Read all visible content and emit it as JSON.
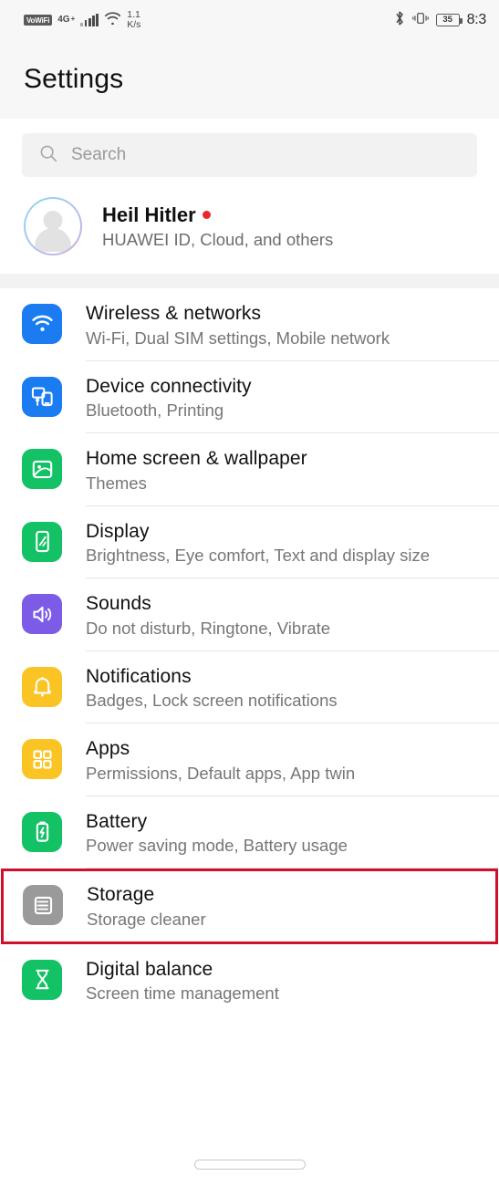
{
  "status_bar": {
    "vowifi_label": "VoWiFi",
    "network_type": "4G",
    "network_type_plus": "+",
    "speed_value": "1.1",
    "speed_unit": "K/s",
    "bluetooth_icon": "bluetooth-icon",
    "vibrate_icon": "vibrate-icon",
    "battery_percent": "35",
    "time": "8:3"
  },
  "header": {
    "title": "Settings"
  },
  "search": {
    "placeholder": "Search",
    "icon": "search-icon"
  },
  "account": {
    "name": "Heil Hitler",
    "subtitle": "HUAWEI ID, Cloud, and others",
    "has_notification_dot": true,
    "avatar_icon": "person-avatar-icon"
  },
  "settings_items": [
    {
      "title": "Wireless & networks",
      "subtitle": "Wi-Fi, Dual SIM settings, Mobile network",
      "icon": "wifi-icon",
      "icon_color": "#1a7cf0",
      "highlighted": false
    },
    {
      "title": "Device connectivity",
      "subtitle": "Bluetooth, Printing",
      "icon": "device-connectivity-icon",
      "icon_color": "#1a7cf0",
      "highlighted": false
    },
    {
      "title": "Home screen & wallpaper",
      "subtitle": "Themes",
      "icon": "wallpaper-image-icon",
      "icon_color": "#12c265",
      "highlighted": false
    },
    {
      "title": "Display",
      "subtitle": "Brightness, Eye comfort, Text and display size",
      "icon": "display-phone-icon",
      "icon_color": "#12c265",
      "highlighted": false
    },
    {
      "title": "Sounds",
      "subtitle": "Do not disturb, Ringtone, Vibrate",
      "icon": "speaker-volume-icon",
      "icon_color": "#7c5ce6",
      "highlighted": false
    },
    {
      "title": "Notifications",
      "subtitle": "Badges, Lock screen notifications",
      "icon": "bell-icon",
      "icon_color": "#fac524",
      "highlighted": false
    },
    {
      "title": "Apps",
      "subtitle": "Permissions, Default apps, App twin",
      "icon": "apps-grid-icon",
      "icon_color": "#fac524",
      "highlighted": false
    },
    {
      "title": "Battery",
      "subtitle": "Power saving mode, Battery usage",
      "icon": "battery-icon",
      "icon_color": "#12c265",
      "highlighted": false
    },
    {
      "title": "Storage",
      "subtitle": "Storage cleaner",
      "icon": "storage-list-icon",
      "icon_color": "#9a9a9a",
      "highlighted": true
    },
    {
      "title": "Digital balance",
      "subtitle": "Screen time management",
      "icon": "hourglass-icon",
      "icon_color": "#12c265",
      "highlighted": false
    }
  ],
  "highlight_color": "#cf1028",
  "navigation": {
    "gesture_pill": "home-gesture-pill"
  }
}
